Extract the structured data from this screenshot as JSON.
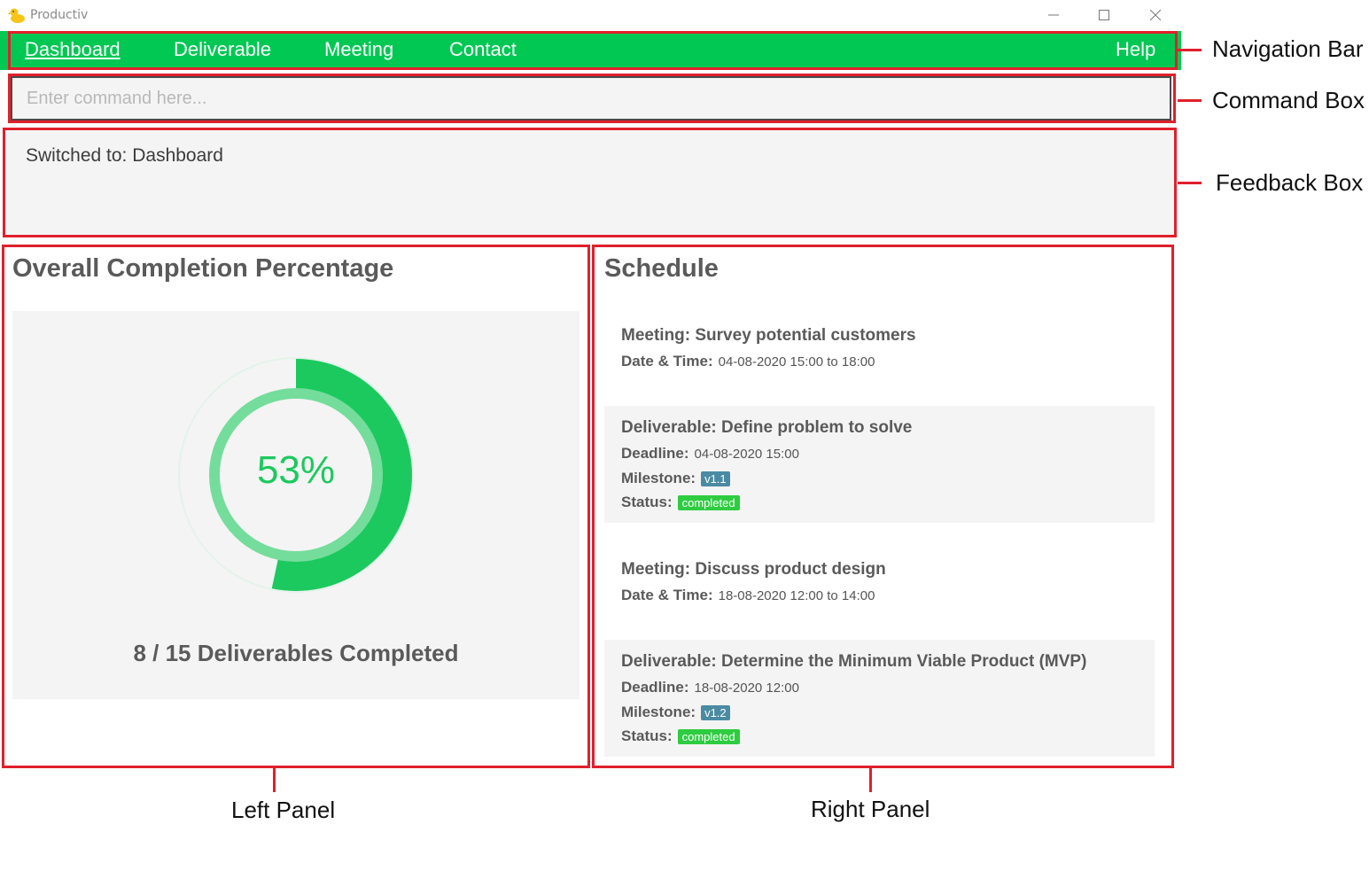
{
  "window": {
    "title": "Productiv"
  },
  "nav": {
    "items": [
      "Dashboard",
      "Deliverable",
      "Meeting",
      "Contact"
    ],
    "help": "Help",
    "active": "Dashboard"
  },
  "command": {
    "placeholder": "Enter command here...",
    "value": ""
  },
  "feedback": {
    "text": "Switched to: Dashboard"
  },
  "left_panel": {
    "title": "Overall Completion Percentage",
    "percent_label": "53%",
    "completed": 8,
    "total": 15,
    "summary": "8 / 15 Deliverables Completed"
  },
  "right_panel": {
    "title": "Schedule",
    "items": [
      {
        "title": "Meeting: Survey potential customers",
        "rows": [
          {
            "label": "Date & Time:",
            "value": "04-08-2020 15:00 to 18:00"
          }
        ]
      },
      {
        "title": "Deliverable: Define problem to solve",
        "deadline_label": "Deadline:",
        "deadline": "04-08-2020 15:00",
        "milestone_label": "Milestone:",
        "milestone": "v1.1",
        "status_label": "Status:",
        "status": "completed"
      },
      {
        "title": "Meeting: Discuss product design",
        "rows": [
          {
            "label": "Date & Time:",
            "value": "18-08-2020 12:00 to 14:00"
          }
        ]
      },
      {
        "title": "Deliverable: Determine the Minimum Viable Product (MVP)",
        "deadline_label": "Deadline:",
        "deadline": "18-08-2020 12:00",
        "milestone_label": "Milestone:",
        "milestone": "v1.2",
        "status_label": "Status:",
        "status": "completed"
      }
    ]
  },
  "annotations": {
    "navigation_bar": "Navigation Bar",
    "command_box": "Command Box",
    "feedback_box": "Feedback Box",
    "left_panel": "Left Panel",
    "right_panel": "Right Panel"
  },
  "colors": {
    "nav_green": "#00c853",
    "ring_green": "#1cc95e",
    "ring_light": "#74dd9c",
    "annotation_red": "#e0202c",
    "milestone_tag": "#4a8ba3",
    "status_tag": "#2ecc40"
  }
}
